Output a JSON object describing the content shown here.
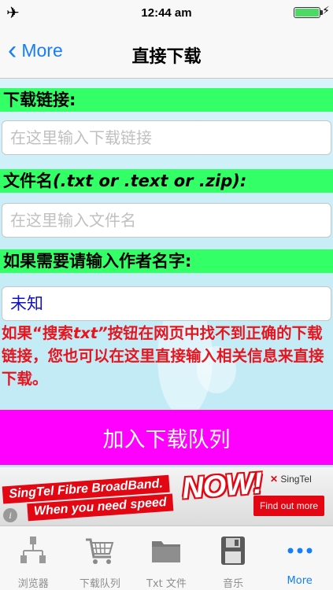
{
  "status": {
    "time": "12:44 am"
  },
  "nav": {
    "back_label": "More",
    "title": "直接下载"
  },
  "form": {
    "link_label": "下载链接:",
    "link_placeholder": "在这里输入下载链接",
    "filename_label_prefix": "文件名",
    "filename_label_italic": "(.txt or .text or .zip):",
    "filename_placeholder": "在这里输入文件名",
    "author_label": "如果需要请输入作者名字:",
    "author_value": "未知",
    "hint_prefix": "如果“搜索",
    "hint_italic": "txt”",
    "hint_rest": "按钮在网页中找不到正确的下载链接，您也可以在这里直接输入相关信息来直接下载。",
    "add_button": "加入下载队列"
  },
  "ad": {
    "line1": "SingTel Fibre BroadBand.",
    "line2": "When you need speed",
    "now": "NOW!",
    "brand": "SingTel",
    "cta": "Find out more",
    "info": "i"
  },
  "tabs": [
    {
      "label": "浏览器",
      "icon": "browser-icon"
    },
    {
      "label": "下载队列",
      "icon": "cart-icon"
    },
    {
      "label": "Txt 文件",
      "icon": "folder-icon"
    },
    {
      "label": "音乐",
      "icon": "music-icon"
    },
    {
      "label": "More",
      "icon": "more-icon"
    }
  ],
  "colors": {
    "accent": "#157efb",
    "label_green": "#33ff66",
    "button_magenta": "#ff00ff",
    "hint_red": "#e8141e",
    "author_blue": "#1010c8"
  }
}
